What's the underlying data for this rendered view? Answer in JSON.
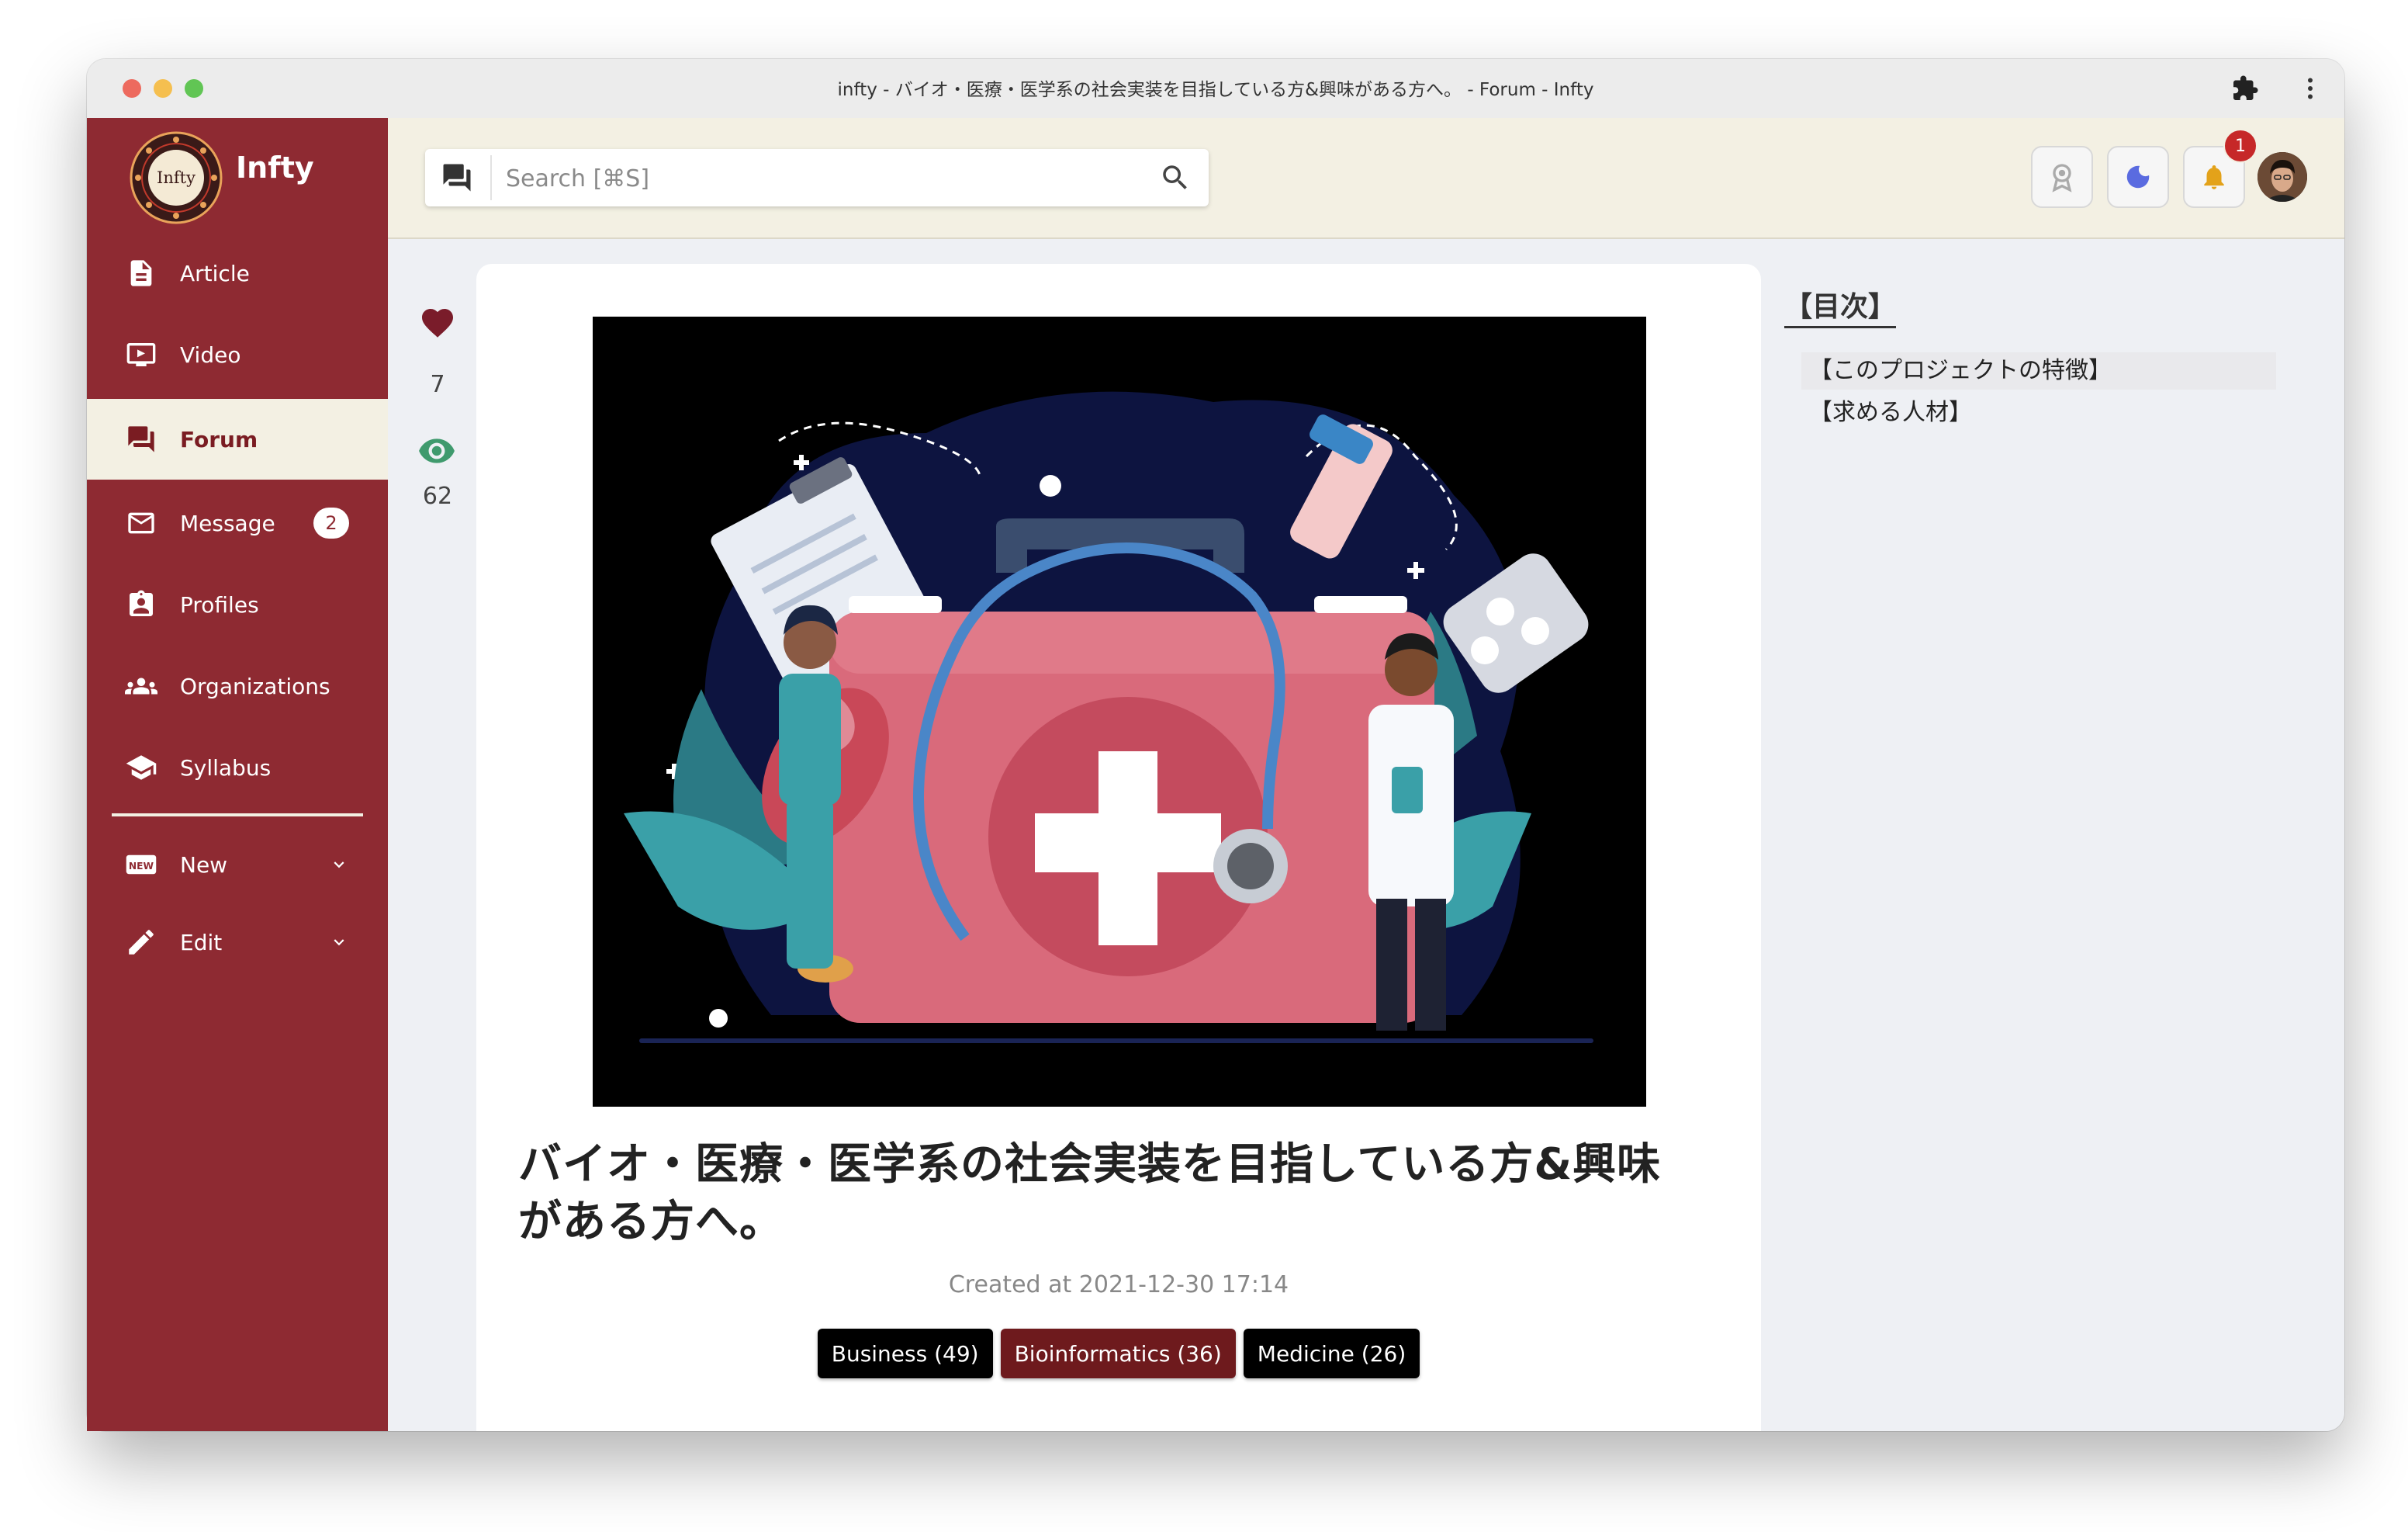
{
  "window": {
    "title": "infty - バイオ・医療・医学系の社会実装を目指している方&興味がある方へ。 - Forum - Infty"
  },
  "sidebar": {
    "brand": "Infty",
    "logo_text": "Infty",
    "items": [
      {
        "label": "Article",
        "icon": "article-icon"
      },
      {
        "label": "Video",
        "icon": "video-icon"
      },
      {
        "label": "Forum",
        "icon": "forum-icon",
        "active": true
      },
      {
        "label": "Message",
        "icon": "mail-icon",
        "badge": "2"
      },
      {
        "label": "Profiles",
        "icon": "profile-badge-icon"
      },
      {
        "label": "Organizations",
        "icon": "groups-icon"
      },
      {
        "label": "Syllabus",
        "icon": "school-icon"
      }
    ],
    "secondary": [
      {
        "label": "New",
        "icon": "new-icon"
      },
      {
        "label": "Edit",
        "icon": "pencil-icon"
      }
    ]
  },
  "header": {
    "search_placeholder": "Search [⌘S]",
    "notification_count": "1"
  },
  "post": {
    "likes": "7",
    "views": "62",
    "title": "バイオ・医療・医学系の社会実装を目指している方&興味がある方へ。",
    "created": "Created at 2021-12-30 17:14",
    "tags": [
      {
        "label": "Business (49)",
        "color": "#000000"
      },
      {
        "label": "Bioinformatics (36)",
        "color": "#6e1a1d"
      },
      {
        "label": "Medicine (26)",
        "color": "#000000"
      }
    ]
  },
  "toc": {
    "title": "【目次】",
    "items": [
      "【このプロジェクトの特徴】",
      "【求める人材】"
    ]
  },
  "colors": {
    "sidebar": "#8e2a32",
    "header": "#f3f0e3",
    "accent": "#7a1c22",
    "view_icon": "#3f9a6d"
  }
}
